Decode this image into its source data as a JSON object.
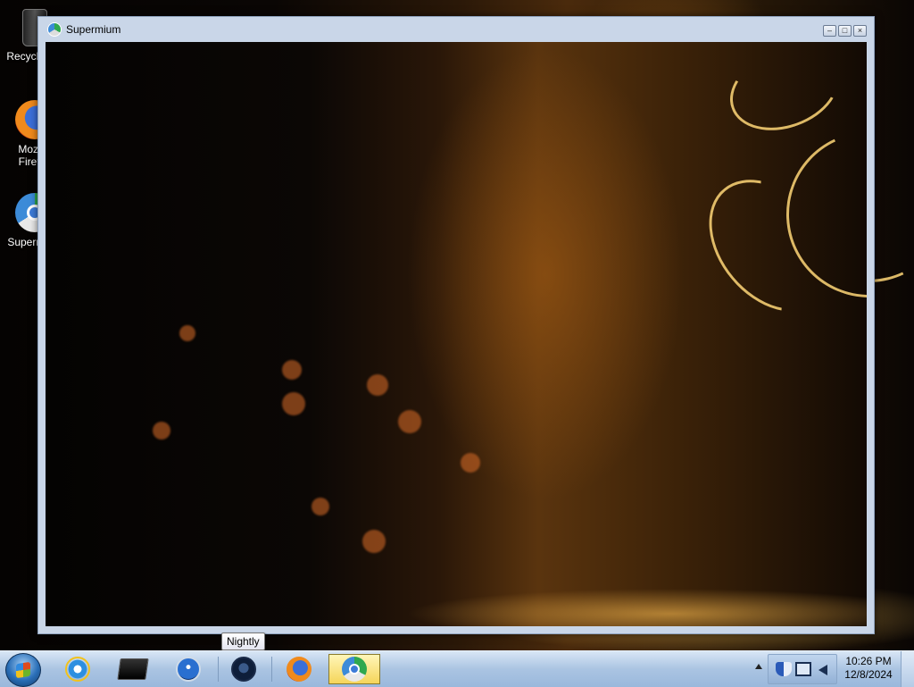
{
  "desktop": {
    "icons": [
      {
        "label": "Recycle Bin",
        "icon": "recycle-bin-icon"
      },
      {
        "label": "Mozilla Firefox",
        "icon": "firefox-icon"
      },
      {
        "label": "Supermium",
        "icon": "supermium-icon"
      }
    ]
  },
  "window": {
    "title": "Supermium",
    "icon": "supermium-icon",
    "buttons": {
      "minimize": "minimize-icon",
      "maximize": "maximize-icon",
      "close": "close-icon"
    }
  },
  "tooltip": {
    "text": "Nightly"
  },
  "taskbar": {
    "start": "start-orb-icon",
    "pinned": [
      {
        "name": "Internet Explorer",
        "icon": "internet-explorer-icon"
      },
      {
        "name": "Windows Explorer",
        "icon": "explorer-icon"
      },
      {
        "name": "Windows Media Player",
        "icon": "media-player-icon"
      },
      {
        "name": "Nightly",
        "icon": "nightly-icon"
      },
      {
        "name": "Mozilla Firefox",
        "icon": "firefox-icon"
      },
      {
        "name": "Supermium",
        "icon": "supermium-icon",
        "active": true
      }
    ],
    "clock": {
      "time": "10:26 PM",
      "date": "12/8/2024"
    }
  }
}
